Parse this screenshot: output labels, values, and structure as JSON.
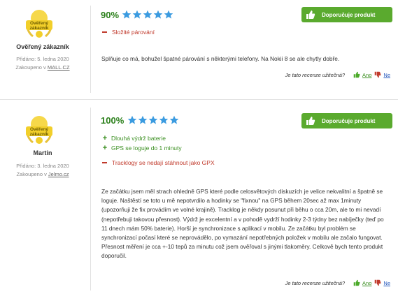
{
  "reviews": [
    {
      "badge_text": "Ověřený zákazník",
      "name": "Ověřený zákazník",
      "date": "Přidáno: 5. ledna 2020",
      "purchased_prefix": "Zakoupeno v ",
      "store": "MALL.CZ",
      "score": "90%",
      "rating_stars": 5,
      "recommend_label": "Doporučuje produkt",
      "pros": [],
      "cons": [
        "Složité párování"
      ],
      "text": "Splňuje co má, bohužel špatné párování s některými telefony. Na Nokii 8 se ale chytly dobře.",
      "helpful_question": "Je tato recenze užitečná?",
      "yes_label": "Ano",
      "no_label": "Ne"
    },
    {
      "badge_text": "Ověřený zákazník",
      "name": "Martin",
      "date": "Přidáno: 3. ledna 2020",
      "purchased_prefix": "Zakoupeno v ",
      "store": "Jelmo.cz",
      "score": "100%",
      "rating_stars": 5,
      "recommend_label": "Doporučuje produkt",
      "pros": [
        "Dlouhá výdrž baterie",
        "GPS se loguje do 1 minuty"
      ],
      "cons": [
        "Tracklogy se nedají stáhnout jako GPX"
      ],
      "text": "Ze začátku jsem měl strach ohledně GPS které podle celosvětových diskuzích je velice nekvalitní a špatně se loguje. Naštěstí se toto u mě nepotvrdilo a hodinky se \"fixnou\" na GPS během 20sec až max 1minuty (upozorňuji že fix provádím ve volné krajině). Tracklog je někdy posunut při běhu o cca 20m, ale to mi nevadí (nepotřebuji takovou přesnost). Výdrž je excelentní a v pohodě vydrží hodinky 2-3 týdny bez nabíječky (teď po 11 dnech mám 50% baterie). Horší je synchronizace s aplikací v mobilu. Ze začátku byl problém se synchronizací počasí které se neprovádělo, po vymazání nepotřebných položek v mobilu ale začalo fungovat. Přesnost měření je cca +-10 tepů za minutu což jsem ověřoval s jinými tlakoměry. Celkově bych tento produkt doporučil.",
      "helpful_question": "Je tato recenze užitečná?",
      "yes_label": "Ano",
      "no_label": "Ne"
    }
  ],
  "colors": {
    "accent_green": "#5aaa2e",
    "star_blue": "#3b9be0",
    "con_red": "#c0392b",
    "badge_gold": "#f2cf2a"
  },
  "icons": [
    "verified-customer-badge-icon",
    "star-icon",
    "thumbs-up-icon",
    "thumbs-down-icon",
    "plus-icon",
    "minus-icon"
  ]
}
